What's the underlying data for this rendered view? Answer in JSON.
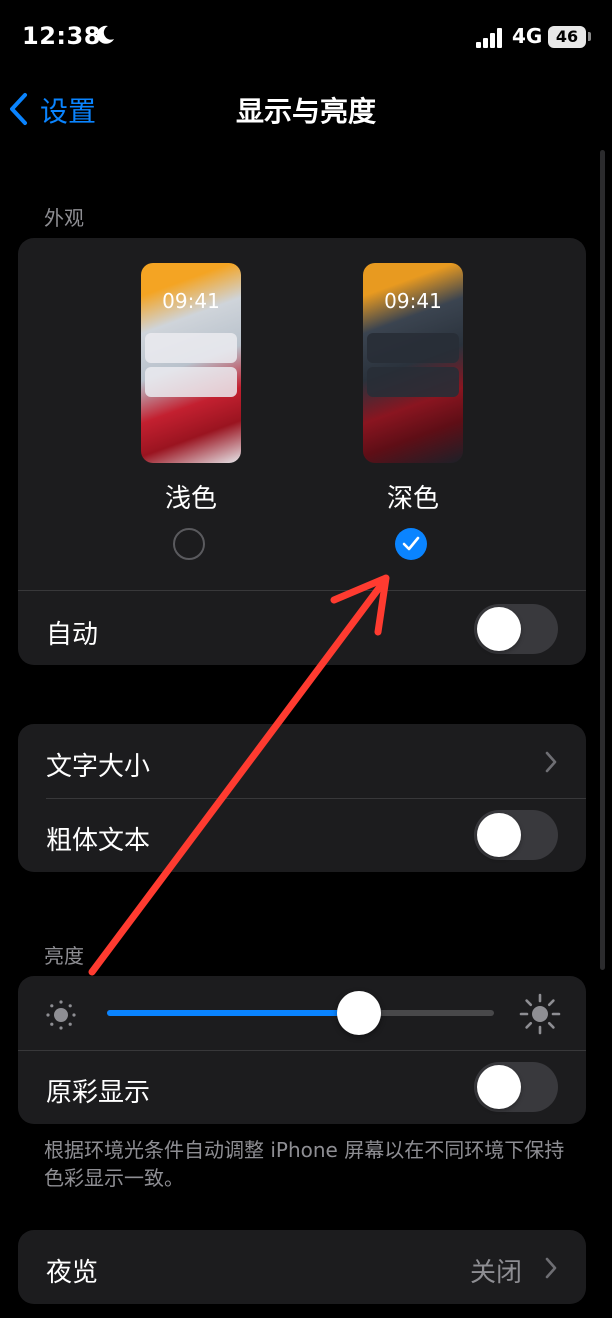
{
  "status_bar": {
    "time": "12:38",
    "network": "4G",
    "battery": "46"
  },
  "nav": {
    "back_label": "设置",
    "title": "显示与亮度"
  },
  "appearance": {
    "section_label": "外观",
    "preview_time": "09:41",
    "options": [
      {
        "label": "浅色",
        "selected": false
      },
      {
        "label": "深色",
        "selected": true
      }
    ],
    "auto_label": "自动",
    "auto_on": false
  },
  "text_section": {
    "text_size_label": "文字大小",
    "bold_text_label": "粗体文本",
    "bold_text_on": false
  },
  "brightness": {
    "section_label": "亮度",
    "level": 0.65,
    "true_tone_label": "原彩显示",
    "true_tone_on": false,
    "footnote": "根据环境光条件自动调整 iPhone 屏幕以在不同环境下保持色彩显示一致。"
  },
  "night_shift": {
    "label": "夜览",
    "value": "关闭"
  },
  "colors": {
    "accent": "#0a84ff",
    "annotation_arrow": "#ff3b30"
  },
  "icons": [
    "moon-icon",
    "signal-icon",
    "back-chevron-icon",
    "check-icon",
    "chevron-right-icon",
    "sun-small-icon",
    "sun-large-icon"
  ]
}
